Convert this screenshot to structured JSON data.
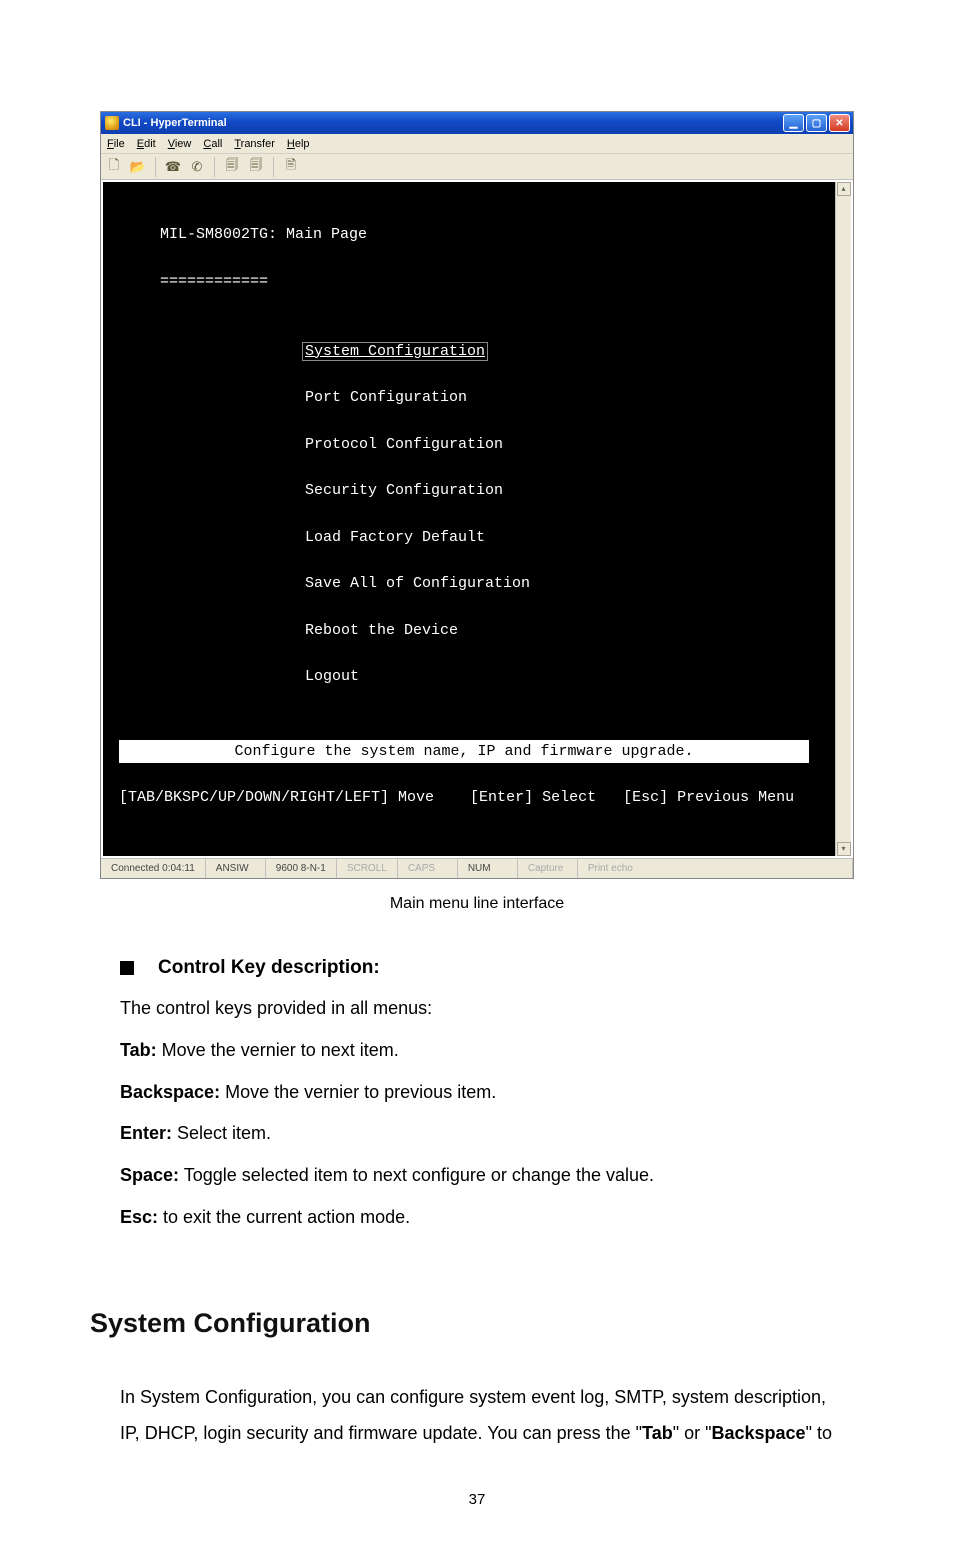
{
  "window": {
    "title": "CLI - HyperTerminal"
  },
  "menubar": {
    "file": "File",
    "edit": "Edit",
    "view": "View",
    "call": "Call",
    "transfer": "Transfer",
    "help": "Help"
  },
  "terminal": {
    "header": "MIL-SM8002TG: Main Page",
    "underline": "============",
    "menu": [
      "System Configuration",
      "Port Configuration",
      "Protocol Configuration",
      "Security Configuration",
      "Load Factory Default",
      "Save All of Configuration",
      "Reboot the Device",
      "Logout"
    ],
    "hint": "Configure the system name, IP and firmware upgrade.",
    "nav": "[TAB/BKSPC/UP/DOWN/RIGHT/LEFT] Move    [Enter] Select   [Esc] Previous Menu"
  },
  "statusbar": {
    "connected": "Connected 0:04:11",
    "emulation": "ANSIW",
    "settings": "9600 8-N-1",
    "scroll": "SCROLL",
    "caps": "CAPS",
    "num": "NUM",
    "capture": "Capture",
    "printecho": "Print echo"
  },
  "caption": "Main menu line interface",
  "doc": {
    "bullet_title": "Control Key description:",
    "intro": "The control keys provided in all menus:",
    "tab_key": "Tab:",
    "tab_text": " Move the vernier to next item.",
    "bksp_key": "Backspace:",
    "bksp_text": " Move the vernier to previous item.",
    "enter_key": "Enter:",
    "enter_text": " Select item.",
    "space_key": "Space:",
    "space_text": " Toggle selected item to next configure or change the value.",
    "esc_key": "Esc:",
    "esc_text": " to exit the current action mode."
  },
  "heading": "System Configuration",
  "sys_para_1": "In System Configuration, you can configure system event log, SMTP, system description,",
  "sys_para_2a": "IP, DHCP, login security and firmware update. You can press the \"",
  "sys_para_tab": "Tab",
  "sys_para_2b": "\" or \"",
  "sys_para_bksp": "Backspace",
  "sys_para_2c": "\" to",
  "page_number": "37"
}
